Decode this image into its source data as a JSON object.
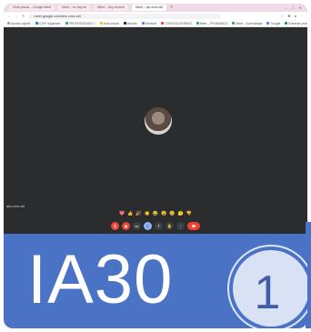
{
  "browser": {
    "tabs": [
      {
        "label": "Vista previa – Google Meet",
        "active": false
      },
      {
        "label": "Meet – no hay se",
        "active": false
      },
      {
        "label": "Meet – hoy reunión",
        "active": false
      },
      {
        "label": "Meet – hip-xxxx-ckt",
        "active": true
      }
    ],
    "new_tab": "+",
    "window_controls": [
      "–",
      "□",
      "✕"
    ],
    "url": "meet.google.com/ahv-xxxx-ckt",
    "bookmarks": [
      {
        "label": "Acceso rápido",
        "color": "#9aa0a6"
      },
      {
        "label": "ICGP Organizer",
        "color": "#1a73e8"
      },
      {
        "label": "PROFESORADO 1",
        "color": "#34a853"
      },
      {
        "label": "Aula virtual",
        "color": "#fbbc04"
      },
      {
        "label": "Moodle",
        "color": "#202124"
      },
      {
        "label": "Webinar",
        "color": "#4285f4"
      },
      {
        "label": "CONVOCATORIAS",
        "color": "#ea4335"
      },
      {
        "label": "Meet – PROBANDO",
        "color": "#34a853"
      },
      {
        "label": "Meet – Aprendizaje",
        "color": "#34a853"
      },
      {
        "label": "Google",
        "color": "#4285f4"
      },
      {
        "label": "Entrenar prueba",
        "color": "#0f9d58"
      }
    ]
  },
  "meet": {
    "meeting_code": "ahv-xxxx-ckt",
    "reactions": [
      "💖",
      "👍",
      "🎉",
      "👏",
      "😂",
      "😮",
      "😢",
      "🤔",
      "👎"
    ],
    "controls": [
      "mic-off",
      "cam-off",
      "cc",
      "emoji",
      "present",
      "raise-hand",
      "more",
      "hangup"
    ]
  },
  "banner": {
    "title": "IA30",
    "badge_number": "1"
  },
  "colors": {
    "banner_blue": "#4a73c6",
    "meet_bg": "#2b2c2e",
    "hangup_red": "#ea4335"
  }
}
